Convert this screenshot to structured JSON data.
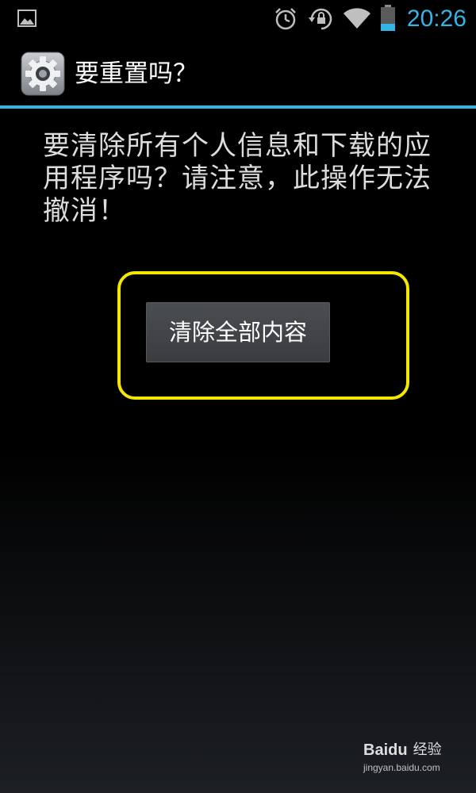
{
  "status_bar": {
    "time": "20:26",
    "icons": [
      "image-notification-icon",
      "alarm-icon",
      "rotation-lock-icon",
      "wifi-icon",
      "battery-icon"
    ],
    "accent_color": "#33b5e5"
  },
  "dialog": {
    "title": "要重置吗？",
    "icon": "settings-gear-icon",
    "message": "要清除所有个人信息和下载的应用程序吗？请注意，此操作无法撤消！",
    "button_label": "清除全部内容",
    "highlight_color": "#f5e600"
  },
  "watermark": {
    "brand": "Baidu",
    "name": "经验",
    "url": "jingyan.baidu.com"
  }
}
